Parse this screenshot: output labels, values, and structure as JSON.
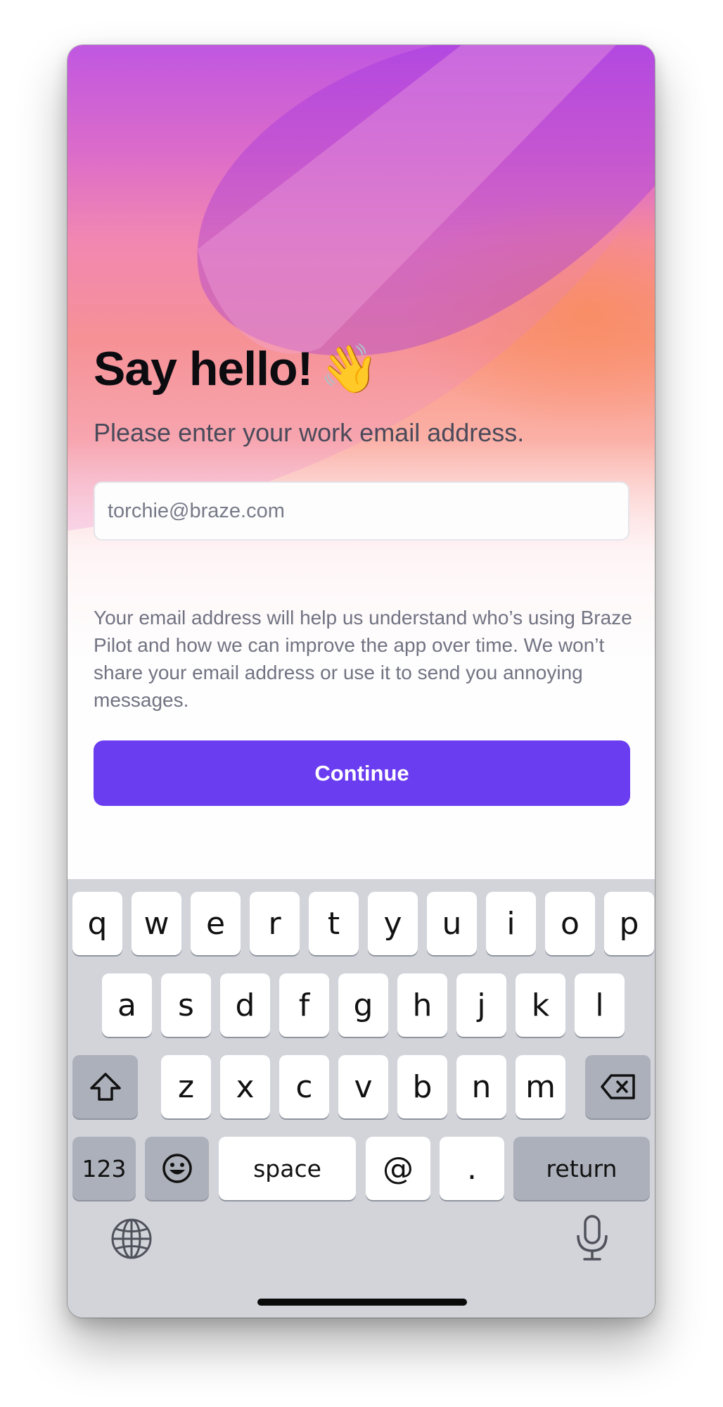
{
  "onboarding": {
    "title": "Say hello!",
    "title_emoji": "👋",
    "subtitle": "Please enter your work email address.",
    "email_placeholder": "torchie@braze.com",
    "email_value": "",
    "privacy_text": "Your email address will help us understand who’s using Braze Pilot and how we can improve the app over time. We won’t share your email address or use it to send you annoying messages.",
    "continue_label": "Continue"
  },
  "colors": {
    "accent": "#6a3df0",
    "keyboard_bg": "#d2d4da"
  },
  "keyboard": {
    "row1": [
      "q",
      "w",
      "e",
      "r",
      "t",
      "y",
      "u",
      "i",
      "o",
      "p"
    ],
    "row2": [
      "a",
      "s",
      "d",
      "f",
      "g",
      "h",
      "j",
      "k",
      "l"
    ],
    "row3": [
      "z",
      "x",
      "c",
      "v",
      "b",
      "n",
      "m"
    ],
    "numbers_label": "123",
    "space_label": "space",
    "at_label": "@",
    "period_label": ".",
    "return_label": "return",
    "icons": [
      "shift-icon",
      "backspace-icon",
      "emoji-icon",
      "globe-icon",
      "microphone-icon"
    ]
  }
}
